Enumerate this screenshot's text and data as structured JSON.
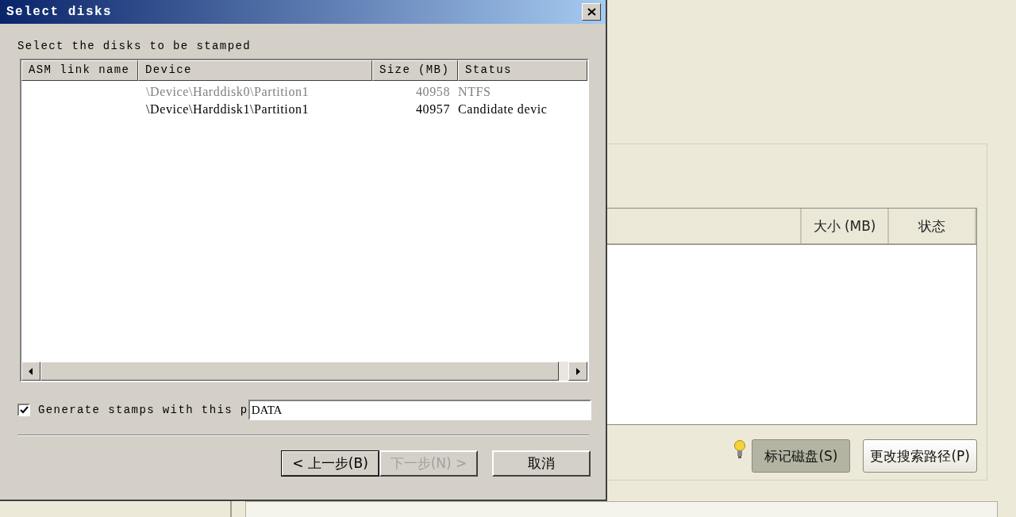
{
  "dialog": {
    "title": "Select disks",
    "prompt": "Select the disks to be stamped",
    "columns": [
      "ASM link name",
      "Device",
      "Size (MB)",
      "Status"
    ],
    "rows": [
      {
        "device": "\\Device\\Harddisk0\\Partition1",
        "size": "40958",
        "status": "NTFS",
        "disabled": true
      },
      {
        "device": "\\Device\\Harddisk1\\Partition1",
        "size": "40957",
        "status": "Candidate devic",
        "disabled": false
      }
    ],
    "stamp_option": {
      "label": "Generate stamps with this p",
      "checked": true,
      "value": "DATA"
    },
    "buttons": [
      {
        "label": "< 上一步(B)",
        "kind": "default",
        "disabled": false
      },
      {
        "label": "下一步(N) >",
        "kind": "normal",
        "disabled": true
      },
      {
        "label": "取消",
        "kind": "normal",
        "disabled": false
      }
    ]
  },
  "background": {
    "columns": [
      "大小 (MB)",
      "状态"
    ],
    "buttons": [
      {
        "label": "标记磁盘(S)",
        "pressed": true
      },
      {
        "label": "更改搜索路径(P)",
        "pressed": false
      }
    ]
  }
}
